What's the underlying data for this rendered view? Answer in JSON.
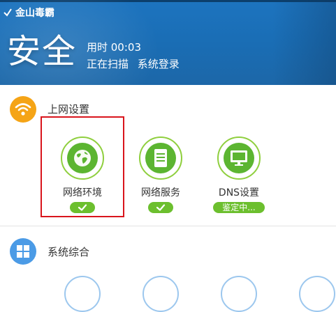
{
  "header": {
    "app_title": "金山毒霸",
    "status_big": "安全",
    "elapsed": "用时 00:03",
    "scan_status": "正在扫描",
    "scan_target": "系统登录"
  },
  "sections": [
    {
      "title": "上网设置",
      "icon": "wifi-icon",
      "items": [
        {
          "label": "网络环境",
          "icon": "globe-icon",
          "status": "check"
        },
        {
          "label": "网络服务",
          "icon": "server-icon",
          "status": "check"
        },
        {
          "label": "DNS设置",
          "icon": "monitor-icon",
          "status_text": "鉴定中..."
        }
      ]
    },
    {
      "title": "系统综合",
      "icon": "windows-icon"
    }
  ],
  "colors": {
    "header_blue": "#1a6eb6",
    "accent_green": "#6cbf2e",
    "wifi_orange": "#f5a416",
    "windows_blue": "#4b9be6",
    "highlight_red": "#d9141c"
  }
}
